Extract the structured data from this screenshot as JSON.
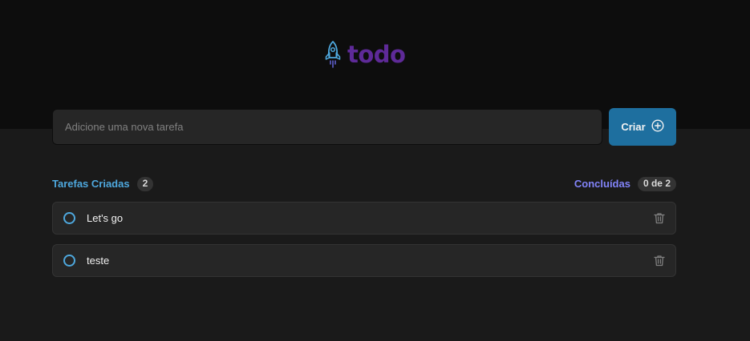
{
  "app": {
    "logo_text": "todo"
  },
  "form": {
    "placeholder": "Adicione uma nova tarefa",
    "value": "",
    "create_label": "Criar"
  },
  "stats": {
    "created_label": "Tarefas Criadas",
    "created_count": "2",
    "done_label": "Concluídas",
    "done_count": "0 de 2"
  },
  "tasks": [
    {
      "text": "Let's go",
      "completed": false
    },
    {
      "text": "teste",
      "completed": false
    }
  ],
  "colors": {
    "brand_light": "#4ea8de",
    "brand_dark": "#1e6f9f",
    "purple": "#8284fa",
    "purple_dark": "#5e2a98"
  },
  "icons": {
    "logo": "rocket-icon",
    "create": "plus-circle-icon",
    "task_check": "circle-icon",
    "task_delete": "trash-icon"
  }
}
